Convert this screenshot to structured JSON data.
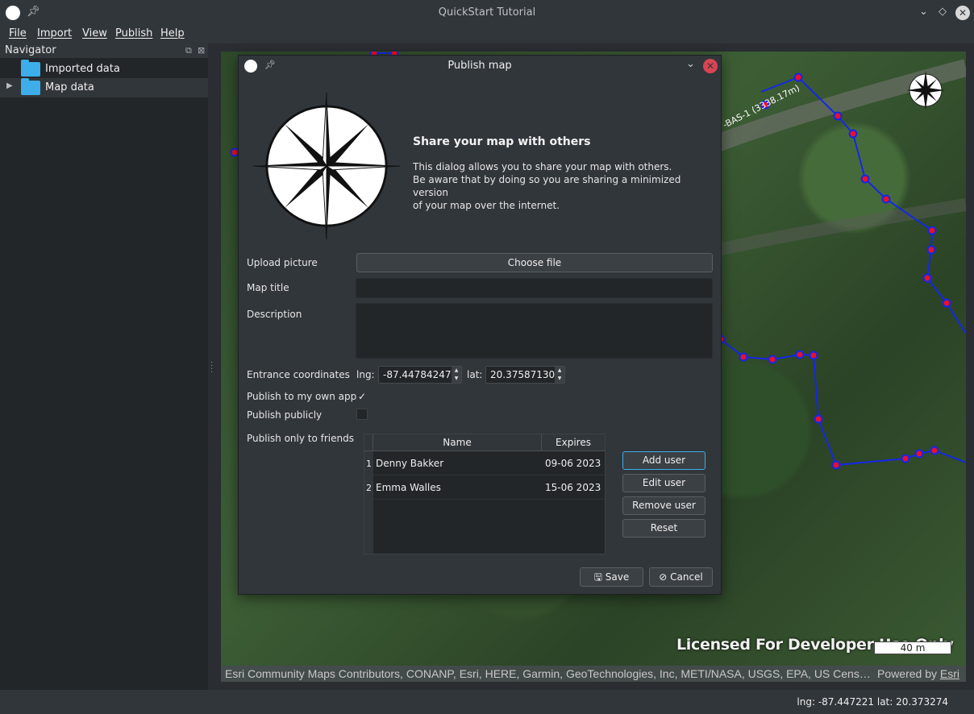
{
  "window": {
    "title": "QuickStart Tutorial"
  },
  "menu": [
    "File",
    "Import",
    "View",
    "Publish",
    "Help"
  ],
  "navigator": {
    "title": "Navigator",
    "items": [
      {
        "label": "Imported data"
      },
      {
        "label": "Map data"
      }
    ]
  },
  "map": {
    "road_label": "-BAS-1 (3338.17m)",
    "license_text": "Licensed For Developer Use Only",
    "scale": "40 m",
    "attribution": "Esri Community Maps Contributors, CONANP, Esri, HERE, Garmin, GeoTechnologies, Inc, METI/NASA, USGS, EPA, US Cens…",
    "powered_by_prefix": "Powered by ",
    "powered_by_link": "Esri"
  },
  "status": {
    "coords": "lng: -87.447221 lat: 20.373274"
  },
  "dialog": {
    "title": "Publish map",
    "heading": "Share your map with others",
    "description_lines": [
      "This dialog allows you to share your map with others.",
      "Be aware that by doing so you are sharing a minimized version",
      "of your map over the internet."
    ],
    "upload_label": "Upload picture",
    "choose_file": "Choose file",
    "map_title_label": "Map title",
    "map_title_value": "",
    "description_label": "Description",
    "description_value": "",
    "entrance_label": "Entrance coordinates",
    "lng_label": "lng:",
    "lng_value": "-87.44784247",
    "lat_label": "lat:",
    "lat_value": "20.37587130",
    "own_app_label": "Publish to my own app",
    "own_app_checked": true,
    "publicly_label": "Publish publicly",
    "publicly_checked": false,
    "friends_label": "Publish only to friends",
    "table": {
      "columns": [
        "Name",
        "Expires"
      ],
      "rows": [
        {
          "idx": "1",
          "name": "Denny Bakker",
          "expires": "09-06 2023"
        },
        {
          "idx": "2",
          "name": "Emma Walles",
          "expires": "15-06 2023"
        }
      ]
    },
    "buttons": {
      "add_user": "Add user",
      "edit_user": "Edit user",
      "remove_user": "Remove user",
      "reset": "Reset",
      "save": "Save",
      "cancel": "Cancel"
    }
  }
}
